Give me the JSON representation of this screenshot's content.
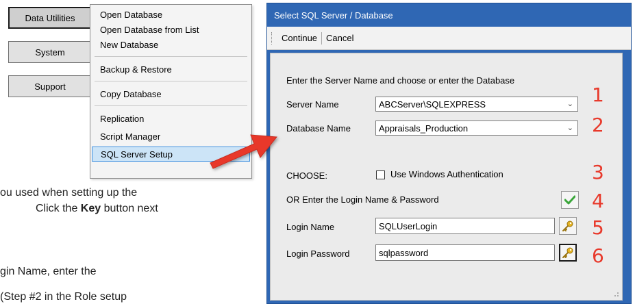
{
  "left_buttons": [
    {
      "label": "Data Utilities"
    },
    {
      "label": "System"
    },
    {
      "label": "Support"
    }
  ],
  "menu": {
    "items": [
      {
        "label": "Open Database"
      },
      {
        "label": "Open Database from List"
      },
      {
        "label": "New Database"
      },
      {
        "label": "Backup & Restore"
      },
      {
        "label": "Copy Database"
      },
      {
        "label": "Replication"
      },
      {
        "label": "Script Manager"
      },
      {
        "label": "SQL Server Setup"
      }
    ],
    "highlighted": "SQL Server Setup"
  },
  "document_text": {
    "line1": "ou used when setting up the",
    "line2_prefix": "Click the ",
    "line2_bold": "Key",
    "line2_suffix": " button next",
    "line3": "gin Name, enter the",
    "line4": "(Step #2 in the Role setup"
  },
  "dialog": {
    "title": "Select SQL Server / Database",
    "toolbar": {
      "continue": "Continue",
      "cancel": "Cancel"
    },
    "instruction": "Enter the Server Name and choose or enter the Database",
    "server_label": "Server Name",
    "server_value": "ABCServer\\SQLEXPRESS",
    "database_label": "Database Name",
    "database_value": "Appraisals_Production",
    "choose_label": "CHOOSE:",
    "windows_auth_label": "Use Windows Authentication",
    "windows_auth_checked": false,
    "or_label": "OR Enter the Login Name & Password",
    "login_label": "Login Name",
    "login_value": "SQLUserLogin",
    "password_label": "Login Password",
    "password_value": "sqlpassword"
  },
  "step_numbers": [
    "1",
    "2",
    "3",
    "4",
    "5",
    "6"
  ],
  "colors": {
    "dialog_title_bg": "#2f67b4",
    "step_number": "#e8392b",
    "arrow": "#e8392b",
    "menu_highlight": "#cce4f7"
  },
  "icons": [
    "check-icon",
    "key-icon",
    "chevron-down-icon",
    "red-arrow-icon"
  ]
}
